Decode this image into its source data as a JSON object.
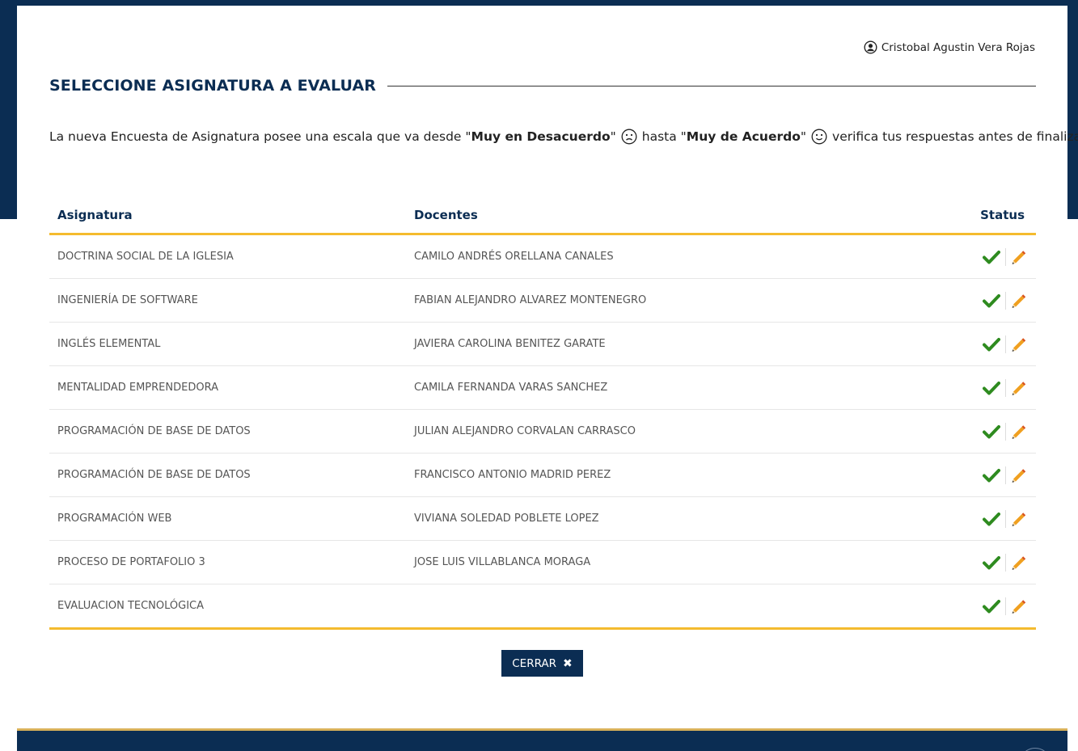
{
  "user": {
    "name": "Cristobal Agustin Vera Rojas",
    "icon": "user-circle-icon"
  },
  "title": "SELECCIONE ASIGNATURA A EVALUAR",
  "intro": {
    "part1": "La nueva Encuesta de Asignatura posee una escala que va desde \"",
    "bold1": "Muy en Desacuerdo",
    "part2": "\"",
    "part3": "hasta \"",
    "bold2": "Muy de Acuerdo",
    "part4": "\"",
    "part5": "verifica tus respuestas antes de finalizar."
  },
  "table": {
    "headers": {
      "subject": "Asignatura",
      "teachers": "Docentes",
      "status": "Status"
    },
    "rows": [
      {
        "subject": "DOCTRINA SOCIAL DE LA IGLESIA",
        "teacher": "CAMILO ANDRÉS ORELLANA CANALES"
      },
      {
        "subject": "INGENIERÍA DE SOFTWARE",
        "teacher": "FABIAN ALEJANDRO ALVAREZ MONTENEGRO"
      },
      {
        "subject": "INGLÉS ELEMENTAL",
        "teacher": "JAVIERA CAROLINA BENITEZ GARATE"
      },
      {
        "subject": "MENTALIDAD EMPRENDEDORA",
        "teacher": "CAMILA FERNANDA VARAS SANCHEZ"
      },
      {
        "subject": "PROGRAMACIÓN DE BASE DE DATOS",
        "teacher": "JULIAN ALEJANDRO CORVALAN CARRASCO"
      },
      {
        "subject": "PROGRAMACIÓN DE BASE DE DATOS",
        "teacher": "FRANCISCO ANTONIO MADRID PEREZ"
      },
      {
        "subject": "PROGRAMACIÓN WEB",
        "teacher": "VIVIANA SOLEDAD POBLETE LOPEZ"
      },
      {
        "subject": "PROCESO DE PORTAFOLIO 3",
        "teacher": "JOSE LUIS VILLABLANCA MORAGA"
      },
      {
        "subject": "EVALUACION TECNOLÓGICA",
        "teacher": ""
      }
    ]
  },
  "close_button": {
    "label": "CERRAR",
    "icon": "close-icon"
  },
  "colors": {
    "navy": "#0b2d53",
    "accent": "#f4bb2e",
    "check": "#2e8b1f",
    "pencil": "#f0a020"
  }
}
